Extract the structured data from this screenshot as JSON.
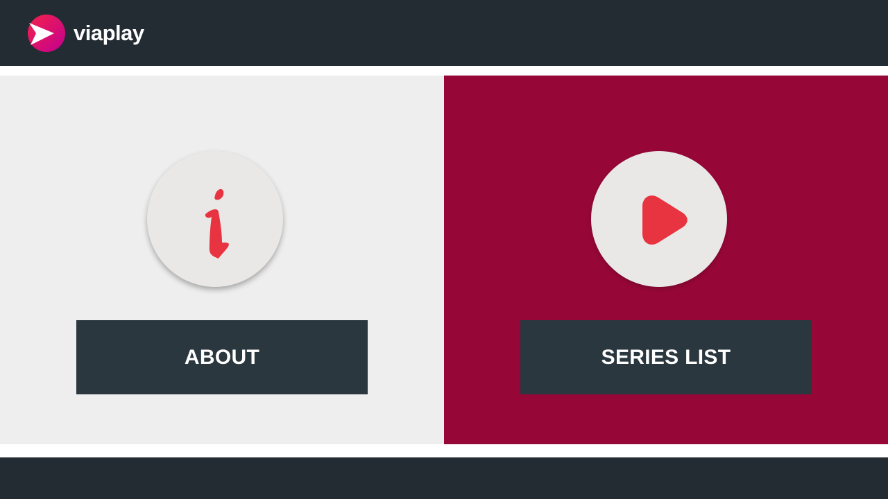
{
  "header": {
    "brand_name": "viaplay",
    "logo_icon": "viaplay-logo-icon"
  },
  "colors": {
    "header_bg": "#232c33",
    "about_panel_bg": "#eeeeee",
    "series_panel_bg": "#960738",
    "button_bg": "#2a373f",
    "icon_circle_bg": "#e9e8e6",
    "icon_red": "#e83341"
  },
  "menu": {
    "about": {
      "label": "ABOUT",
      "icon": "info-icon"
    },
    "series_list": {
      "label": "SERIES LIST",
      "icon": "play-icon"
    }
  }
}
